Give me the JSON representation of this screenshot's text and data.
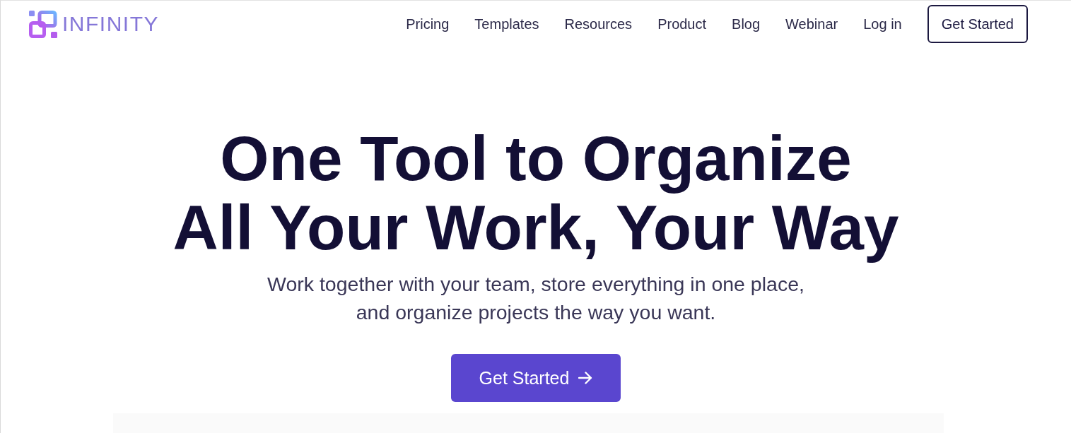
{
  "header": {
    "logo": {
      "wordmark": "INFINITY"
    },
    "nav": [
      "Pricing",
      "Templates",
      "Resources",
      "Product",
      "Blog",
      "Webinar",
      "Log in"
    ],
    "cta": "Get Started"
  },
  "hero": {
    "title_lines": [
      "One Tool to Organize",
      "All Your Work, Your Way"
    ],
    "subtitle_lines": [
      "Work together with your team, store everything in one place,",
      "and organize projects the way you want."
    ],
    "button": "Get Started"
  }
}
